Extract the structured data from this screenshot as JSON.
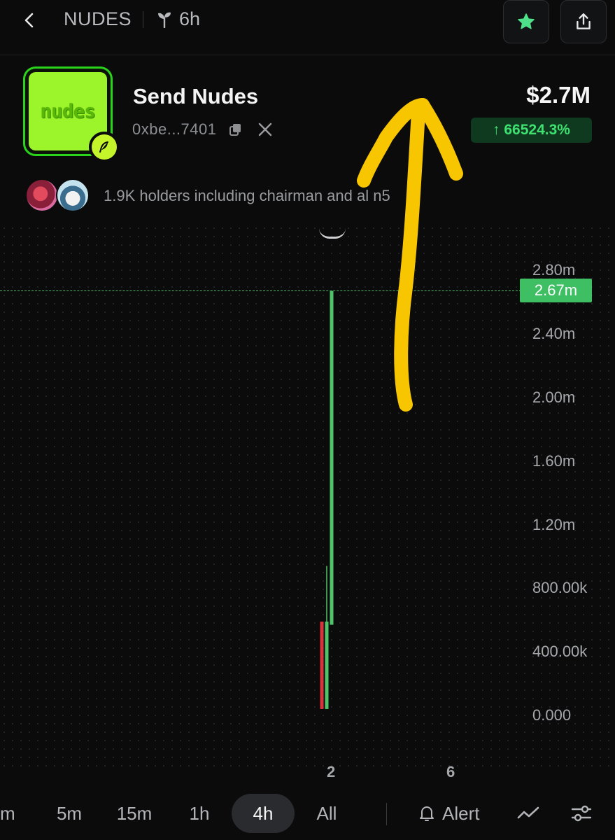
{
  "header": {
    "symbol": "NUDES",
    "age": "6h"
  },
  "token": {
    "logo_text": "nudes",
    "name": "Send Nudes",
    "address": "0xbe...7401",
    "market_cap": "$2.7M",
    "change": "↑ 66524.3%"
  },
  "holders": {
    "text": "1.9K holders including chairman and al n5"
  },
  "chart_data": {
    "type": "candlestick",
    "current_price_label": "2.67m",
    "y_ticks": [
      "2.80m",
      "2.40m",
      "2.00m",
      "1.60m",
      "1.20m",
      "800.00k",
      "400.00k",
      "0.000"
    ],
    "x_ticks": [
      "2",
      "6"
    ],
    "candles": [
      {
        "open": 590000,
        "close": 40000,
        "high": 590000,
        "low": 40000,
        "direction": "down"
      },
      {
        "open": 40000,
        "close": 590000,
        "high": 940000,
        "low": 40000,
        "direction": "up"
      },
      {
        "open": 570000,
        "close": 2670000,
        "high": 2670000,
        "low": 570000,
        "direction": "up"
      }
    ]
  },
  "timeframes": [
    {
      "label": "m"
    },
    {
      "label": "5m"
    },
    {
      "label": "15m"
    },
    {
      "label": "1h"
    },
    {
      "label": "4h",
      "active": true
    },
    {
      "label": "All"
    }
  ],
  "toolbar": {
    "alert_label": "Alert"
  },
  "colors": {
    "accent_green": "#3fbf63",
    "candle_up": "#4fc46a",
    "candle_down": "#d8343c",
    "annotation_yellow": "#f7c600"
  }
}
